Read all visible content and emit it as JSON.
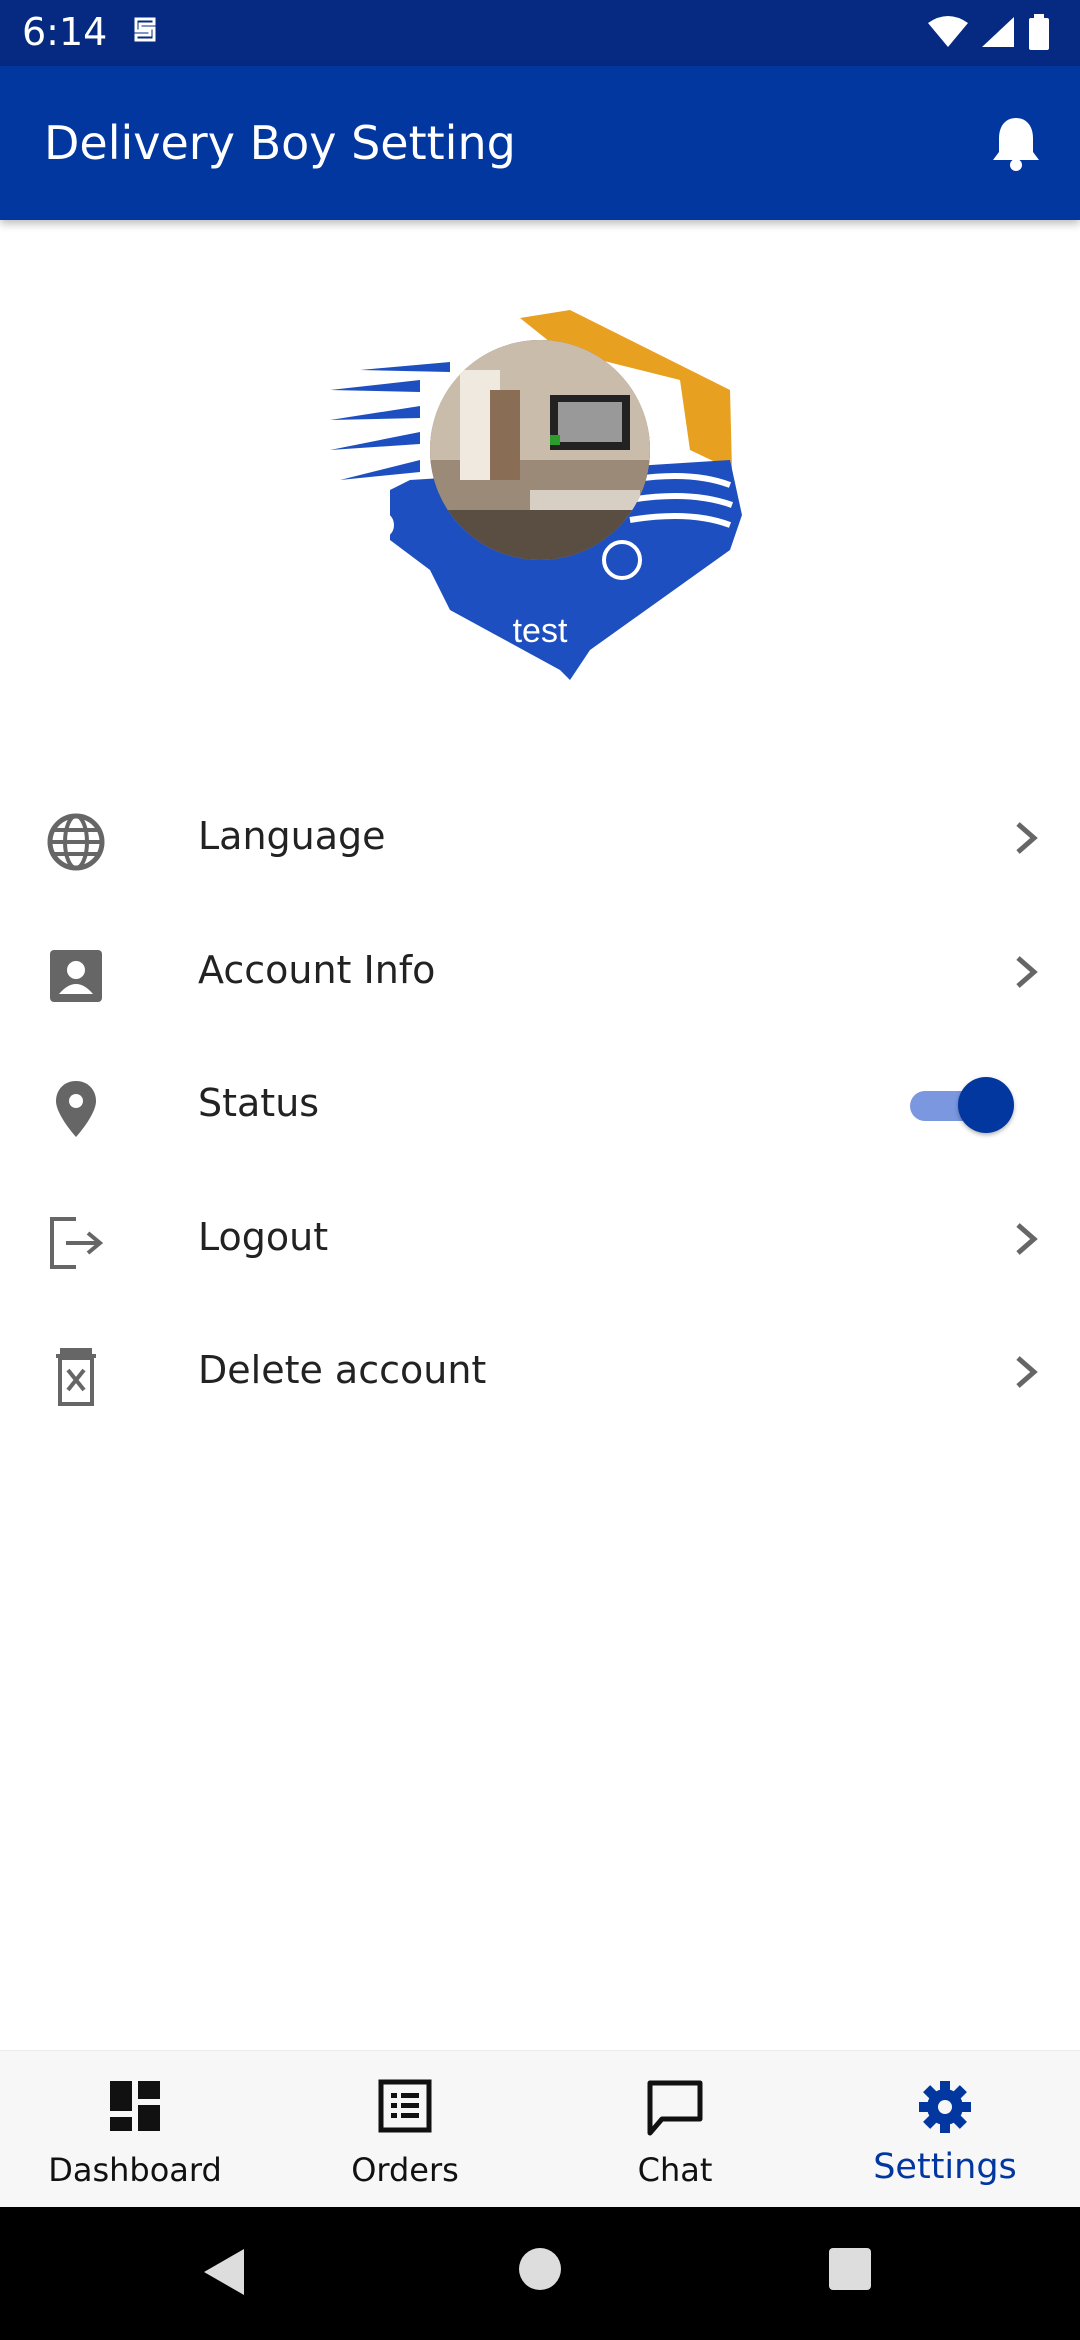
{
  "status_bar": {
    "time": "6:14"
  },
  "app_bar": {
    "title": "Delivery Boy Setting"
  },
  "profile": {
    "name": "test"
  },
  "menu": {
    "items": [
      {
        "label": "Language",
        "icon": "globe-icon"
      },
      {
        "label": "Account Info",
        "icon": "account-box-icon"
      },
      {
        "label": "Status",
        "icon": "location-pin-icon",
        "toggle_on": true
      },
      {
        "label": "Logout",
        "icon": "logout-icon"
      },
      {
        "label": "Delete account",
        "icon": "delete-account-icon"
      }
    ]
  },
  "bottom_nav": {
    "items": [
      {
        "label": "Dashboard",
        "icon": "dashboard-icon"
      },
      {
        "label": "Orders",
        "icon": "orders-list-icon"
      },
      {
        "label": "Chat",
        "icon": "chat-icon"
      },
      {
        "label": "Settings",
        "icon": "settings-gear-icon",
        "active": true
      }
    ]
  },
  "colors": {
    "primary": "#0237a0",
    "status_bar": "#062a82",
    "logo_orange": "#e8a020",
    "logo_blue": "#1e4fc0",
    "toggle_track": "#7b97e0"
  }
}
